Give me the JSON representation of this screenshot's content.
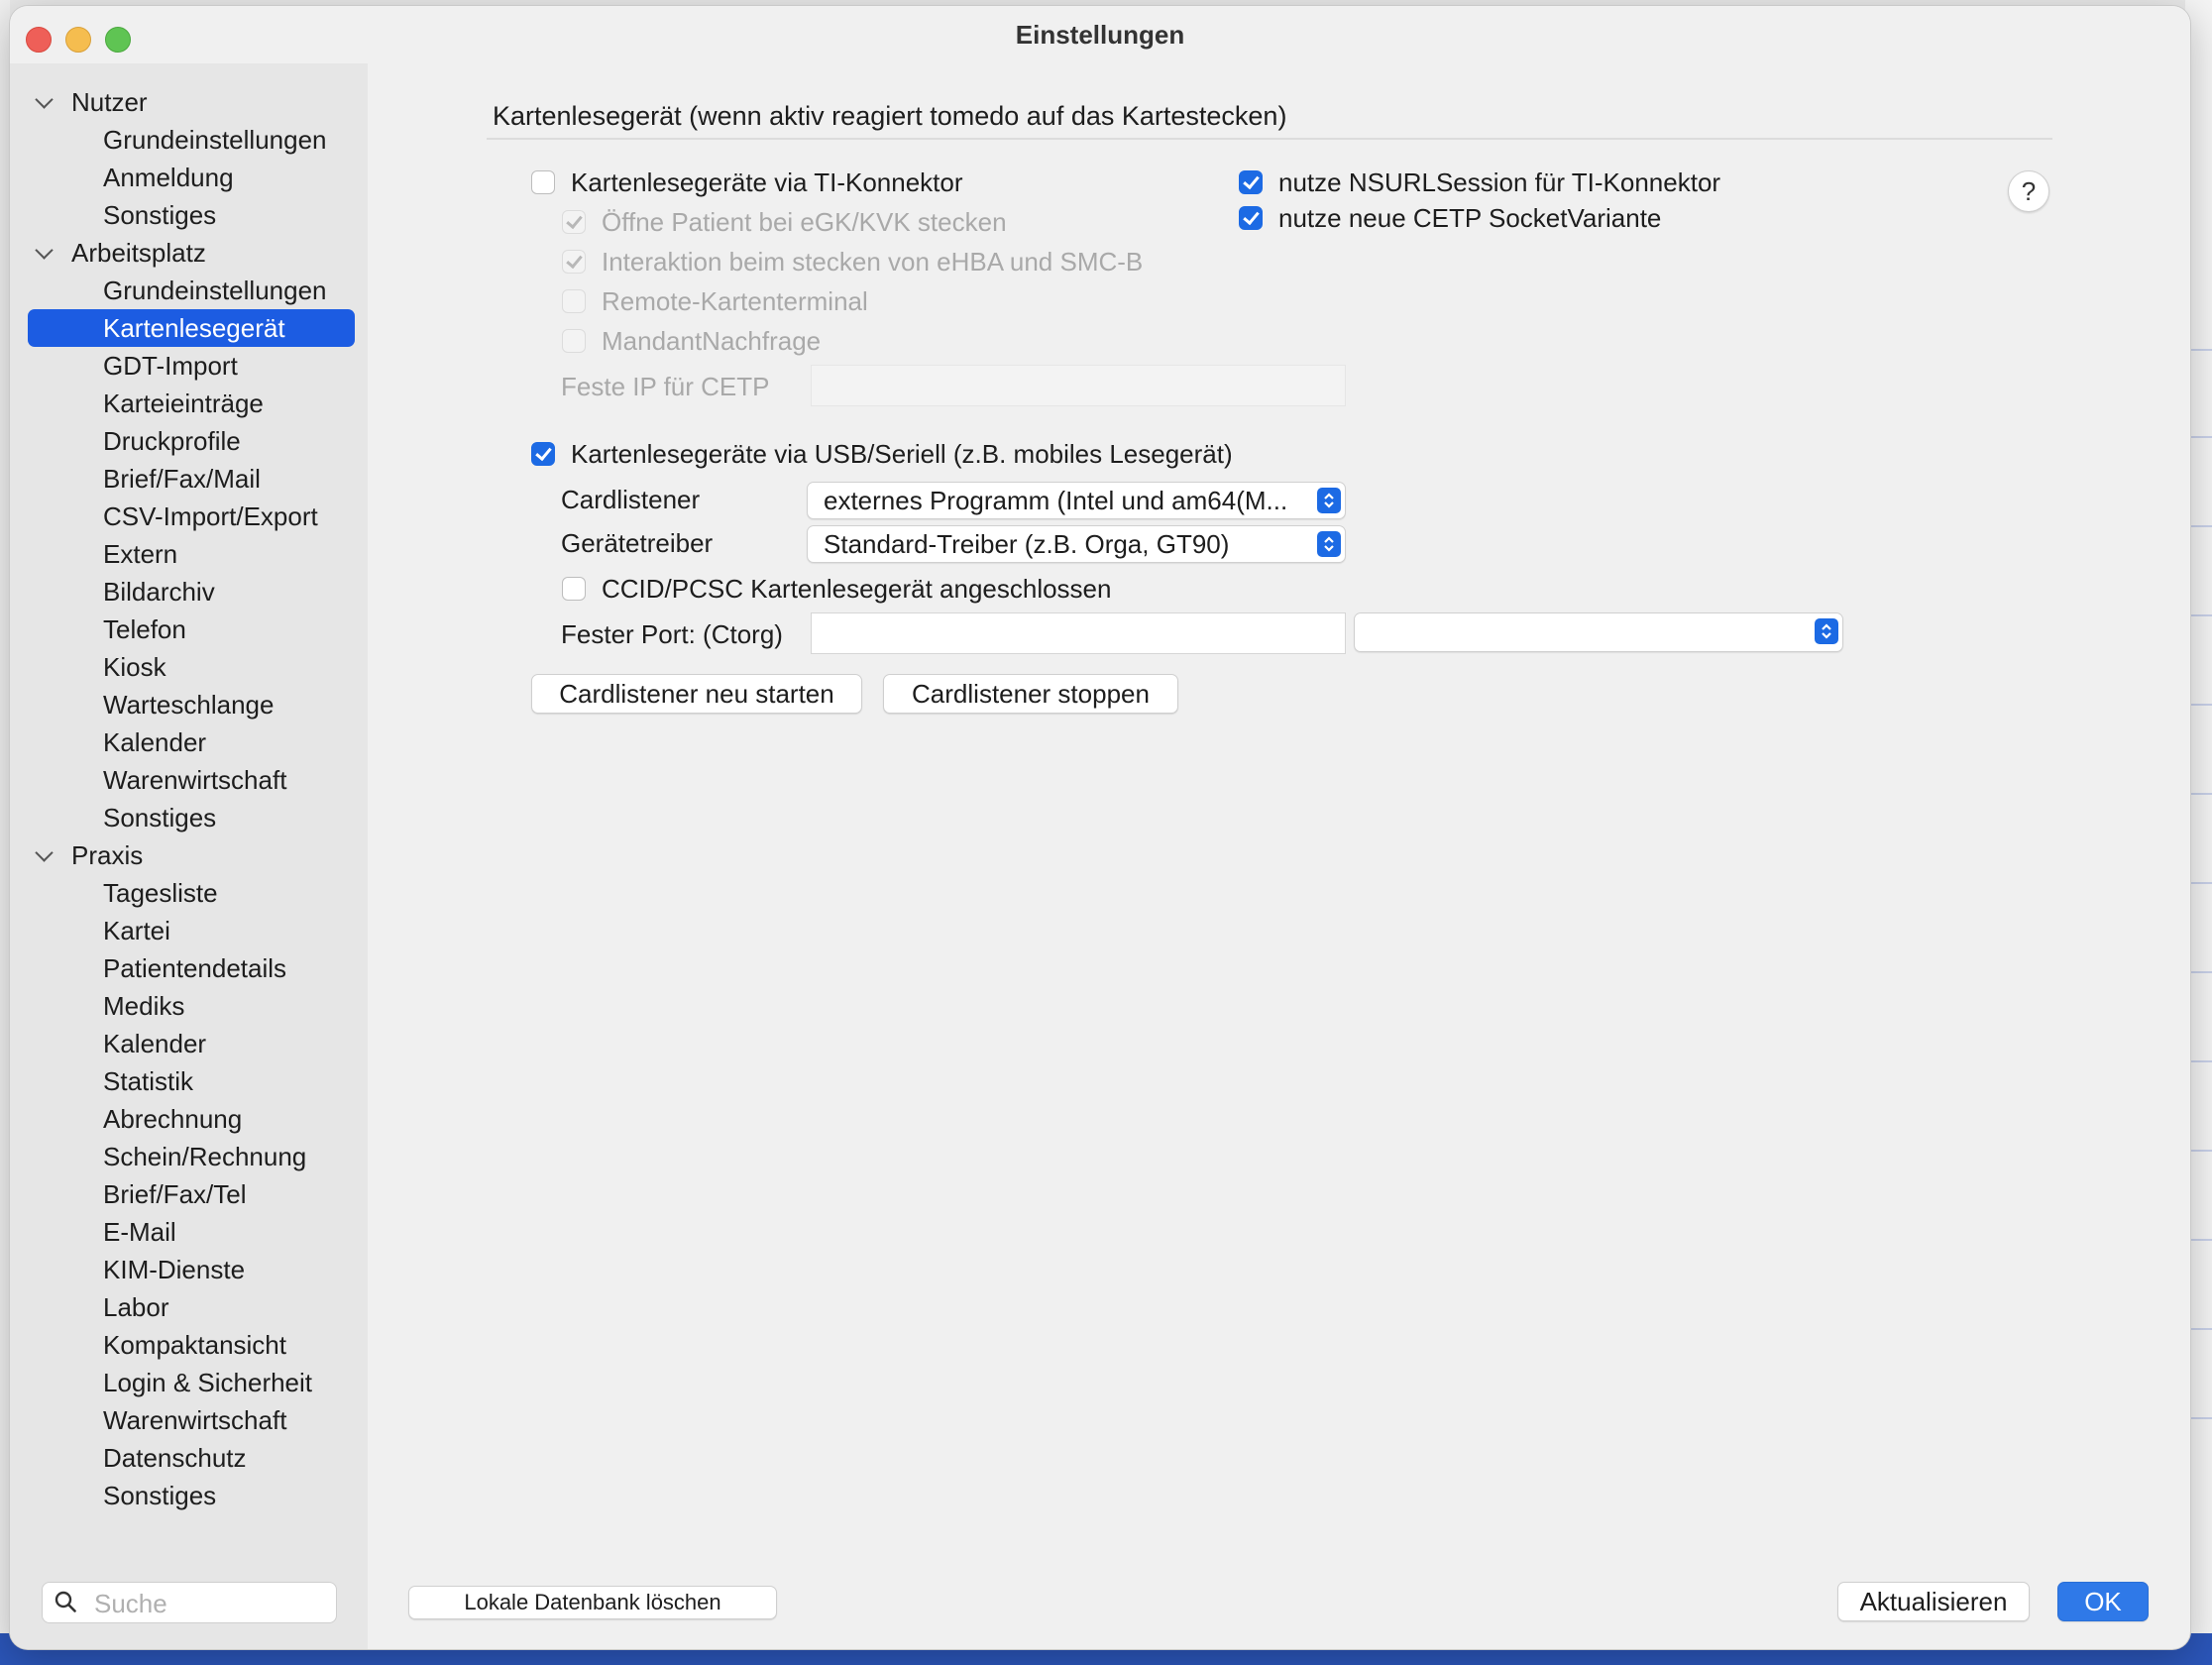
{
  "window": {
    "title": "Einstellungen"
  },
  "sidebar": {
    "groups": [
      {
        "label": "Nutzer",
        "items": [
          "Grundeinstellungen",
          "Anmeldung",
          "Sonstiges"
        ]
      },
      {
        "label": "Arbeitsplatz",
        "items": [
          "Grundeinstellungen",
          "Kartenlesegerät",
          "GDT-Import",
          "Karteieinträge",
          "Druckprofile",
          "Brief/Fax/Mail",
          "CSV-Import/Export",
          "Extern",
          "Bildarchiv",
          "Telefon",
          "Kiosk",
          "Warteschlange",
          "Kalender",
          "Warenwirtschaft",
          "Sonstiges"
        ]
      },
      {
        "label": "Praxis",
        "items": [
          "Tagesliste",
          "Kartei",
          "Patientendetails",
          "Mediks",
          "Kalender",
          "Statistik",
          "Abrechnung",
          "Schein/Rechnung",
          "Brief/Fax/Tel",
          "E-Mail",
          "KIM-Dienste",
          "Labor",
          "Kompaktansicht",
          "Login & Sicherheit",
          "Warenwirtschaft",
          "Datenschutz",
          "Sonstiges"
        ]
      }
    ],
    "selected": "Kartenlesegerät",
    "search_placeholder": "Suche"
  },
  "content": {
    "section_title": "Kartenlesegerät (wenn aktiv reagiert tomedo auf das Kartestecken)",
    "ti": {
      "main_label": "Kartenlesegeräte via TI-Konnektor",
      "open_patient_label": "Öffne Patient bei eGK/KVK stecken",
      "interaction_label": "Interaktion beim stecken von eHBA und SMC-B",
      "remote_label": "Remote-Kartenterminal",
      "mandant_label": "MandantNachfrage",
      "fixed_ip_label": "Feste IP für CETP",
      "fixed_ip_value": ""
    },
    "right_options": {
      "nsurl_label": "nutze NSURLSession für TI-Konnektor",
      "cetp_label": "nutze neue CETP SocketVariante"
    },
    "help_label": "?",
    "usb": {
      "main_label": "Kartenlesegeräte via USB/Seriell (z.B. mobiles Lesegerät)",
      "cardlistener_label": "Cardlistener",
      "cardlistener_value": "externes Programm (Intel und am64(M...",
      "driver_label": "Gerätetreiber",
      "driver_value": "Standard-Treiber (z.B. Orga, GT90)",
      "ccid_label": "CCID/PCSC Kartenlesegerät angeschlossen",
      "port_label": "Fester Port: (Ctorg)",
      "port_value": "",
      "port_select_value": ""
    },
    "buttons": {
      "restart": "Cardlistener neu starten",
      "stop": "Cardlistener stoppen"
    }
  },
  "footer": {
    "delete_db": "Lokale Datenbank löschen",
    "refresh": "Aktualisieren",
    "ok": "OK"
  },
  "colors": {
    "accent": "#1c5ce2",
    "checkbox": "#1c6ae4"
  }
}
